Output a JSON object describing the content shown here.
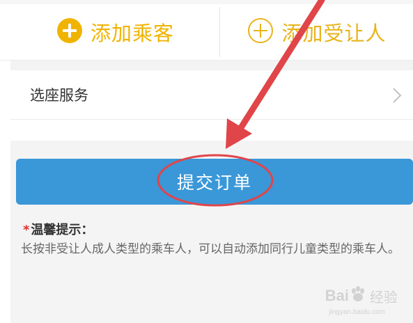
{
  "passenger_actions": {
    "add_passenger_label": "添加乘客",
    "add_protected_label": "添加受让人"
  },
  "seat_service": {
    "label": "选座服务"
  },
  "submit": {
    "label": "提交订单"
  },
  "tip": {
    "star": "*",
    "title": "温馨提示：",
    "body": "长按非受让人成人类型的乘车人，可以自动添加同行儿童类型的乘车人。"
  },
  "watermark": {
    "brand": "Bai",
    "sub": "经验",
    "url": "jingyan.baidu.com"
  },
  "colors": {
    "accent_yellow": "#f0b400",
    "submit_blue": "#3a97d8",
    "annotation_red": "#e0454a",
    "tip_star_red": "#e03131"
  },
  "icons": {
    "add_passenger": "plus-circle-filled-icon",
    "add_protected": "plus-circle-outline-icon",
    "seat_chevron": "chevron-right-icon",
    "arrow": "red-arrow-annotation",
    "ellipse": "red-ellipse-annotation",
    "watermark": "baidu-paw-icon"
  }
}
